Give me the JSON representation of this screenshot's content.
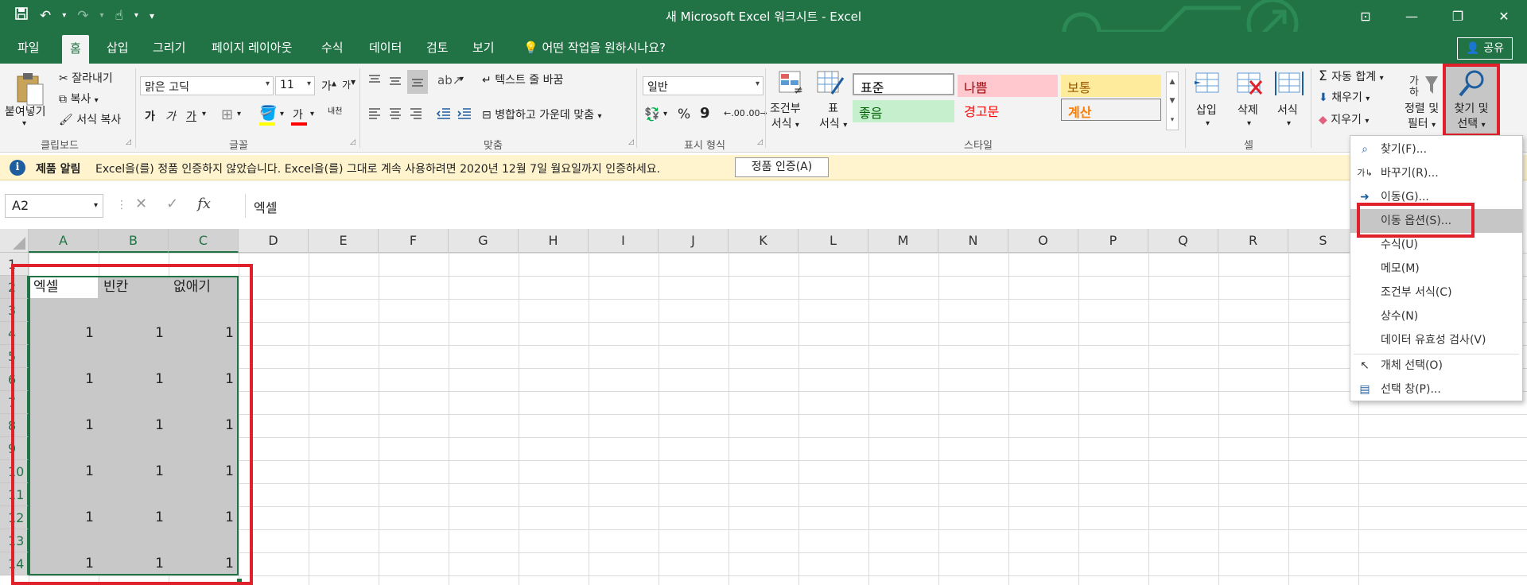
{
  "window": {
    "title": "새 Microsoft Excel 워크시트 - Excel",
    "qat_dropdown": "▾"
  },
  "tabs": [
    "파일",
    "홈",
    "삽입",
    "그리기",
    "페이지 레이아웃",
    "수식",
    "데이터",
    "검토",
    "보기"
  ],
  "tell_me": "어떤 작업을 원하시나요?",
  "share_label": "공유",
  "ribbon": {
    "clipboard": {
      "paste": "붙여넣기",
      "cut": "잘라내기",
      "copy": "복사",
      "format_painter": "서식 복사",
      "label": "클립보드"
    },
    "font": {
      "name": "맑은 고딕",
      "size": "11",
      "bold": "가",
      "italic": "가",
      "underline": "가",
      "grow": "가",
      "shrink": "가",
      "color_glyph": "가",
      "phonetic": "내천",
      "label": "글꼴"
    },
    "alignment": {
      "wrap_text": "텍스트 줄 바꿈",
      "merge_center": "병합하고 가운데 맞춤",
      "label": "맞춤"
    },
    "number": {
      "format": "일반",
      "percent": "%",
      "comma": "9",
      "inc_decimal": ".00",
      "dec_decimal": ".00",
      "label": "표시 형식"
    },
    "styles": {
      "conditional": [
        "조건부",
        "서식"
      ],
      "format_table": [
        "표",
        "서식"
      ],
      "cells": [
        {
          "text": "표준",
          "bg": "#ffffff",
          "fg": "#000000"
        },
        {
          "text": "나쁨",
          "bg": "#ffc7ce",
          "fg": "#9c0006"
        },
        {
          "text": "보통",
          "bg": "#ffeb9c",
          "fg": "#9c5700"
        },
        {
          "text": "좋음",
          "bg": "#c6efce",
          "fg": "#006100"
        },
        {
          "text": "경고문",
          "bg": "#f3f3f3",
          "fg": "#ff0000"
        },
        {
          "text": "계산",
          "bg": "#f2f2f2",
          "fg": "#fa7d00"
        }
      ],
      "label": "스타일"
    },
    "cells": {
      "insert": "삽입",
      "delete": "삭제",
      "format": "서식",
      "label": "셀"
    },
    "editing": {
      "autosum": "자동 합계",
      "fill": "채우기",
      "clear": "지우기",
      "sort": [
        "정렬 및",
        "필터"
      ],
      "find": [
        "찾기 및",
        "선택"
      ]
    }
  },
  "notification": {
    "title": "제품 알림",
    "message": "Excel을(를) 정품 인증하지 않았습니다. Excel을(를) 그대로 계속 사용하려면 2020년 12월 7일 월요일까지 인증하세요.",
    "button": "정품 인증(A)"
  },
  "formula_bar": {
    "name_box": "A2",
    "cancel": "✕",
    "enter": "✓",
    "fx": "fx",
    "value": "엑셀"
  },
  "columns": [
    "A",
    "B",
    "C",
    "D",
    "E",
    "F",
    "G",
    "H",
    "I",
    "J",
    "K",
    "L",
    "M",
    "N",
    "O",
    "P",
    "Q",
    "R",
    "S"
  ],
  "rows": [
    "1",
    "2",
    "3",
    "4",
    "5",
    "6",
    "7",
    "8",
    "9",
    "10",
    "11",
    "12",
    "13",
    "14"
  ],
  "cells": [
    {
      "ref": "A2",
      "value": "엑셀"
    },
    {
      "ref": "B2",
      "value": "빈칸"
    },
    {
      "ref": "C2",
      "value": "없애기"
    },
    {
      "ref": "A4",
      "value": "1"
    },
    {
      "ref": "B4",
      "value": "1"
    },
    {
      "ref": "C4",
      "value": "1"
    },
    {
      "ref": "A6",
      "value": "1"
    },
    {
      "ref": "B6",
      "value": "1"
    },
    {
      "ref": "C6",
      "value": "1"
    },
    {
      "ref": "A8",
      "value": "1"
    },
    {
      "ref": "B8",
      "value": "1"
    },
    {
      "ref": "C8",
      "value": "1"
    },
    {
      "ref": "A10",
      "value": "1"
    },
    {
      "ref": "B10",
      "value": "1"
    },
    {
      "ref": "C10",
      "value": "1"
    },
    {
      "ref": "A12",
      "value": "1"
    },
    {
      "ref": "B12",
      "value": "1"
    },
    {
      "ref": "C12",
      "value": "1"
    },
    {
      "ref": "A14",
      "value": "1"
    },
    {
      "ref": "B14",
      "value": "1"
    },
    {
      "ref": "C14",
      "value": "1"
    }
  ],
  "find_select_menu": [
    {
      "icon": "search-icon",
      "label": "찾기(F)..."
    },
    {
      "icon": "replace-icon",
      "label": "바꾸기(R)..."
    },
    {
      "icon": "goto-arrow-icon",
      "label": "이동(G)..."
    },
    {
      "icon": "",
      "label": "이동 옵션(S)...",
      "highlighted": true
    },
    {
      "icon": "",
      "label": "수식(U)"
    },
    {
      "icon": "",
      "label": "메모(M)"
    },
    {
      "icon": "",
      "label": "조건부 서식(C)"
    },
    {
      "icon": "",
      "label": "상수(N)"
    },
    {
      "icon": "",
      "label": "데이터 유효성 검사(V)"
    },
    {
      "icon": "pointer-icon",
      "label": "개체 선택(O)"
    },
    {
      "icon": "selection-pane-icon",
      "label": "선택 창(P)..."
    }
  ],
  "colors": {
    "excel_green": "#217346",
    "highlight_red": "#e0202a",
    "selection_gray": "#c8c8c8"
  }
}
